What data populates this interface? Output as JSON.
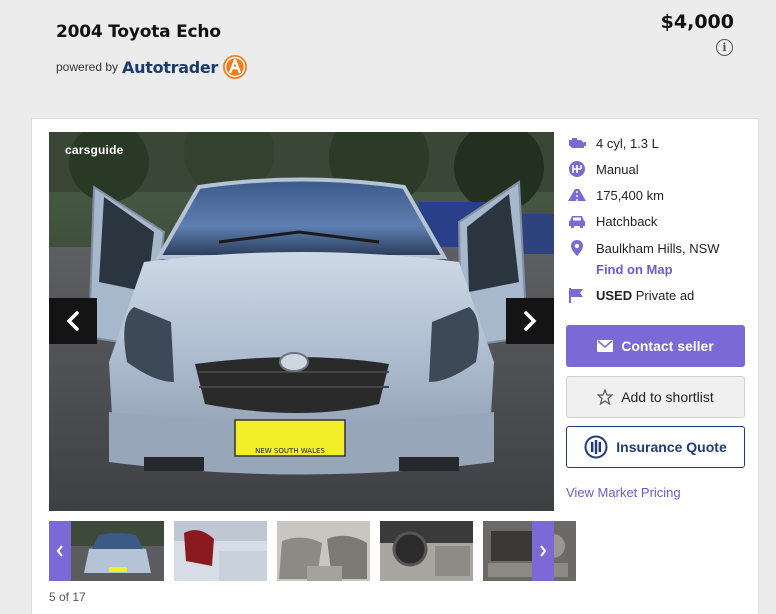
{
  "listing": {
    "title": "2004 Toyota Echo",
    "powered_by": "powered by",
    "brand": "Autotrader",
    "price": "$4,000",
    "info_glyph": "i"
  },
  "gallery": {
    "watermark": "carsguide",
    "counter": "5 of 17",
    "plate_text": "NEW SOUTH WALES"
  },
  "specs": {
    "engine": "4 cyl, 1.3 L",
    "transmission": "Manual",
    "odometer": "175,400 km",
    "body": "Hatchback",
    "location": "Baulkham Hills, NSW",
    "find_on_map": "Find on Map",
    "condition": "USED",
    "seller_type": "Private ad"
  },
  "actions": {
    "contact": "Contact seller",
    "shortlist": "Add to shortlist",
    "insurance": "Insurance Quote",
    "market": "View Market Pricing"
  },
  "colors": {
    "accent": "#7b6ad6",
    "insurance_blue": "#1f3b79",
    "brand_orange": "#f47b20"
  },
  "icons": [
    "info-icon",
    "autotrader-logo",
    "engine-icon",
    "gearbox-icon",
    "odometer-icon",
    "car-icon",
    "location-pin-icon",
    "flag-icon",
    "mail-icon",
    "star-icon",
    "allianz-icon",
    "chevron-left-icon",
    "chevron-right-icon"
  ]
}
